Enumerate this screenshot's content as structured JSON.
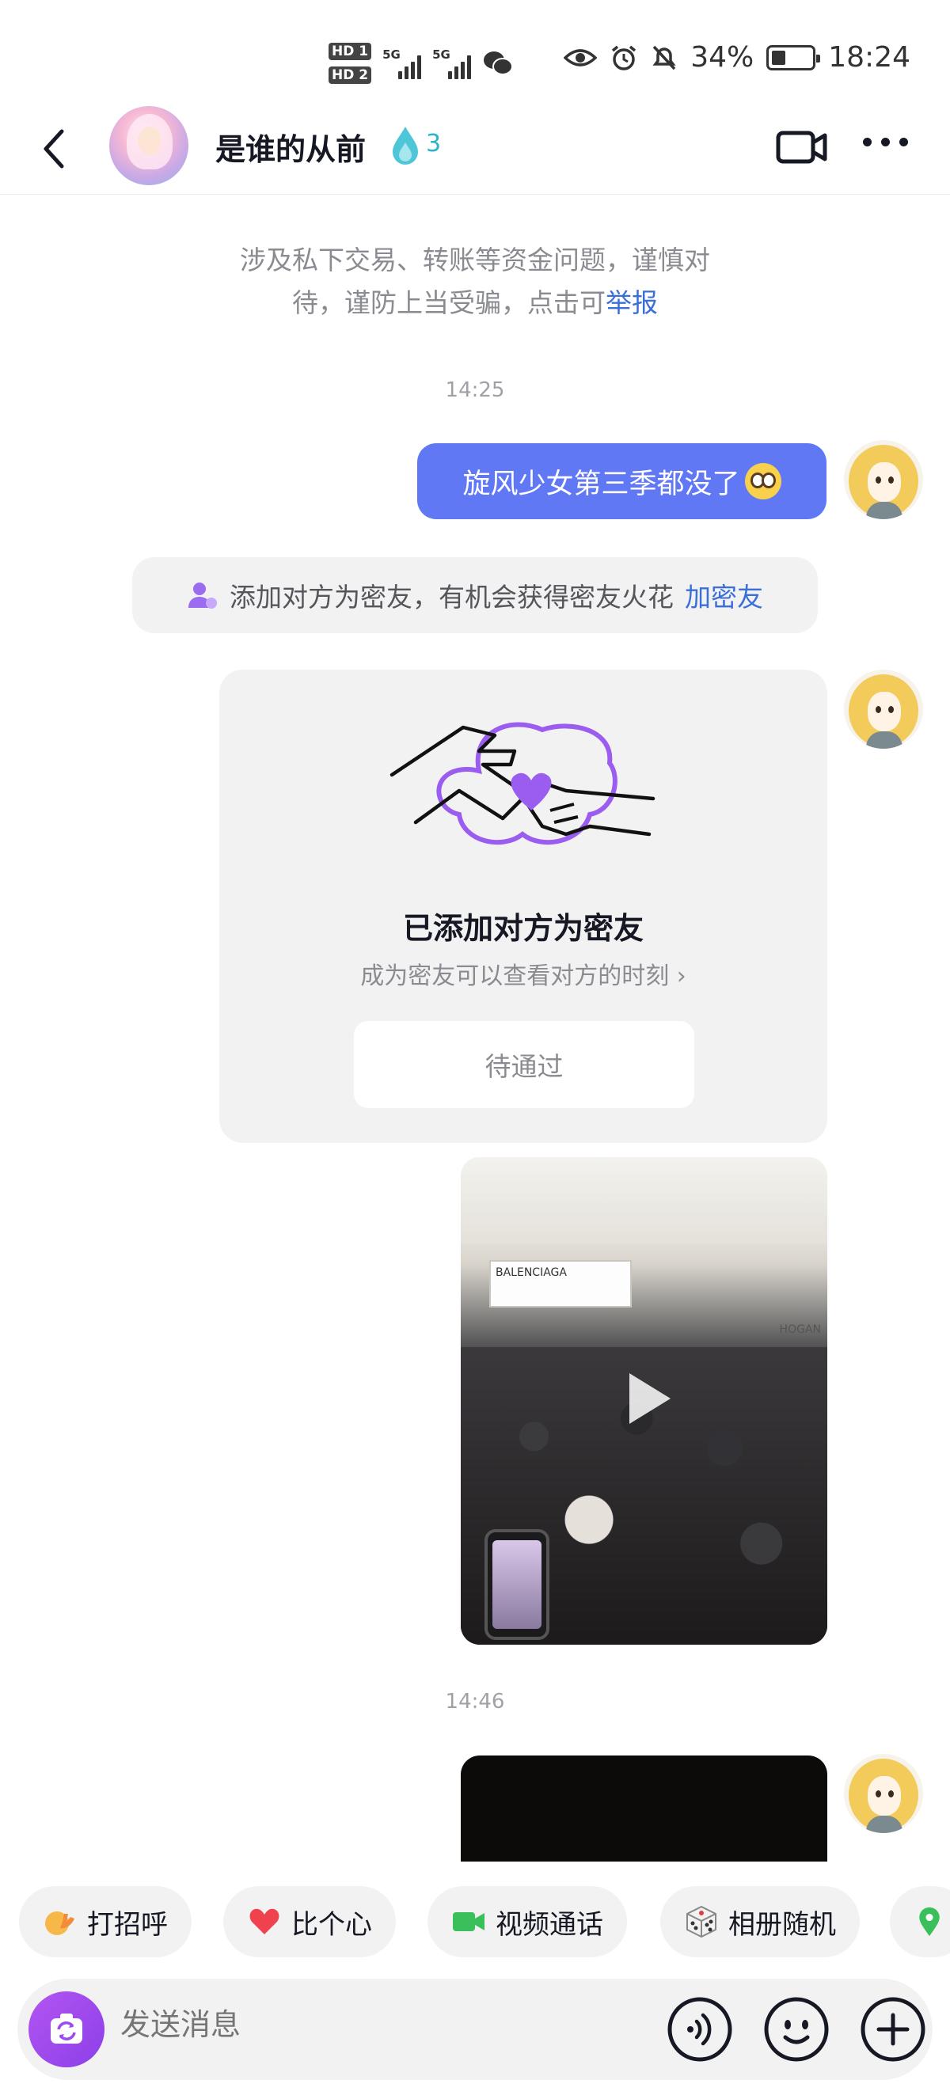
{
  "status_bar": {
    "time": "18:24",
    "battery": "34%",
    "battery_level": 0.34,
    "hd1": "HD 1",
    "hd2": "HD 2",
    "net1": "5G",
    "net2": "5G"
  },
  "header": {
    "contact_name": "是谁的从前",
    "flame_count": "3"
  },
  "chat": {
    "safety_notice_line1": "涉及私下交易、转账等资金问题，谨慎对",
    "safety_notice_line2": "待，谨防上当受骗，点击可",
    "safety_notice_link": "举报",
    "time_1": "14:25",
    "message_1": "旋风少女第三季都没了",
    "system_tip": "添加对方为密友，有机会获得密友火花",
    "system_tip_link": "加密友",
    "card_title": "已添加对方为密友",
    "card_subtitle": "成为密友可以查看对方的时刻",
    "card_button": "待通过",
    "video_store_sign": "BALENCIAGA",
    "video_store_sign_right": "HOGAN",
    "time_2": "14:46"
  },
  "quick_actions": [
    {
      "label": "打招呼",
      "icon": "wave-hand-icon"
    },
    {
      "label": "比个心",
      "icon": "heart-icon"
    },
    {
      "label": "视频通话",
      "icon": "video-camera-icon"
    },
    {
      "label": "相册随机",
      "icon": "dice-icon"
    }
  ],
  "input": {
    "placeholder": "发送消息"
  },
  "colors": {
    "accent": "#6178F5",
    "link": "#3A6FD8",
    "purple": "#8B3FE8",
    "flame": "#2BB3C7"
  }
}
